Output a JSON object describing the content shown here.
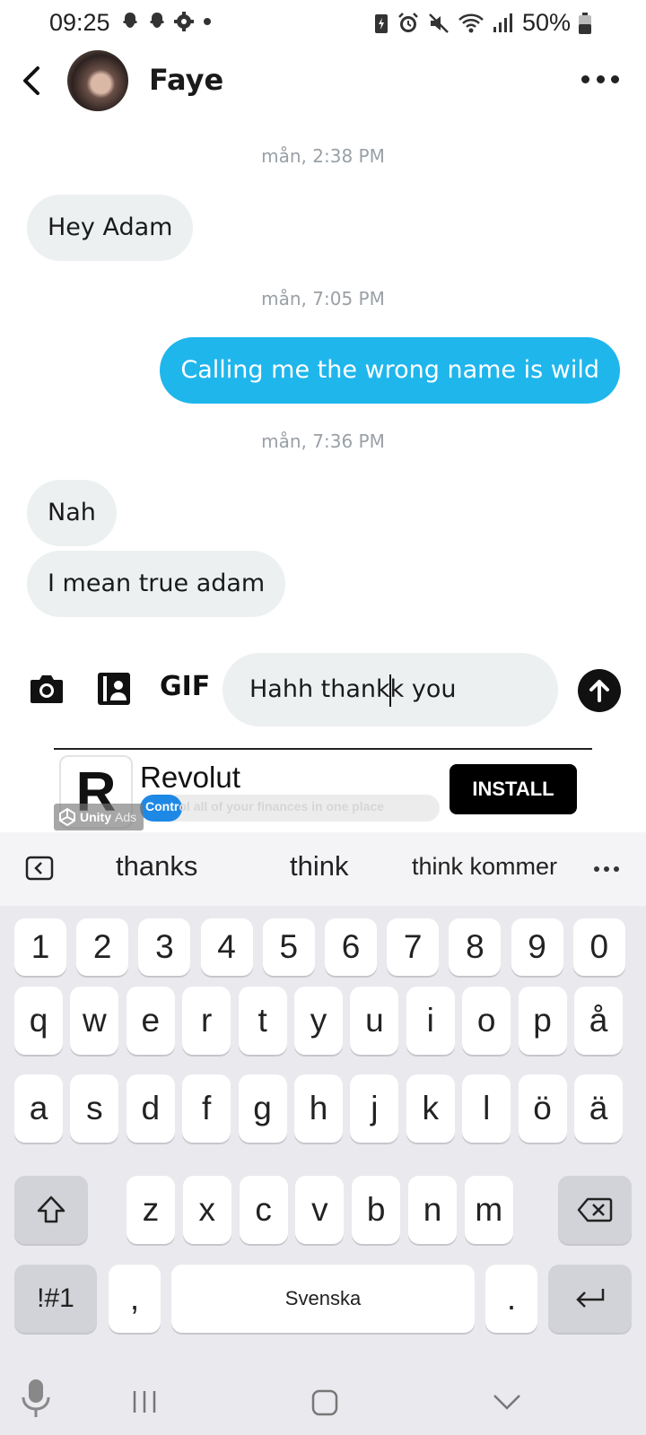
{
  "status_bar": {
    "time": "09:25",
    "battery": "50%",
    "left_icons": [
      "snapchat-icon",
      "snapchat-icon",
      "settings-gear-icon",
      "dot-icon"
    ],
    "right_icons": [
      "battery-saver-icon",
      "alarm-icon",
      "mute-icon",
      "wifi-icon",
      "signal-icon",
      "battery-icon"
    ]
  },
  "header": {
    "contact_name": "Faye"
  },
  "messages": [
    {
      "type": "timestamp",
      "text": "mån, 2:38 PM"
    },
    {
      "type": "incoming",
      "text": "Hey Adam"
    },
    {
      "type": "timestamp",
      "text": "mån, 7:05 PM"
    },
    {
      "type": "outgoing",
      "text": "Calling me the wrong name is wild"
    },
    {
      "type": "timestamp",
      "text": "mån, 7:36 PM"
    },
    {
      "type": "incoming",
      "text": "Nah"
    },
    {
      "type": "incoming",
      "text": "I mean true adam"
    }
  ],
  "composer": {
    "gif_label": "GIF",
    "input_value": "Hahh thankk you"
  },
  "ad": {
    "title": "Revolut",
    "tagline_part1": "Contr",
    "tagline_part2": "ol all of your finances in one place",
    "install_label": "INSTALL",
    "logo_letter": "R",
    "badge_brand": "Unity",
    "badge_ads": "Ads",
    "progress_fraction": 0.14
  },
  "keyboard": {
    "suggestions": [
      "thanks",
      "think",
      "think kommer"
    ],
    "row_numbers": [
      "1",
      "2",
      "3",
      "4",
      "5",
      "6",
      "7",
      "8",
      "9",
      "0"
    ],
    "row1": [
      "q",
      "w",
      "e",
      "r",
      "t",
      "y",
      "u",
      "i",
      "o",
      "p",
      "å"
    ],
    "row2": [
      "a",
      "s",
      "d",
      "f",
      "g",
      "h",
      "j",
      "k",
      "l",
      "ö",
      "ä"
    ],
    "row3": [
      "z",
      "x",
      "c",
      "v",
      "b",
      "n",
      "m"
    ],
    "symbols_label": "!#1",
    "comma_label": ",",
    "space_label": "Svenska",
    "period_label": "."
  },
  "colors": {
    "outgoing_bubble": "#1fb6ec",
    "incoming_bubble": "#ecf0f1",
    "timestamp": "#9aa0a6",
    "install_button": "#000000"
  }
}
